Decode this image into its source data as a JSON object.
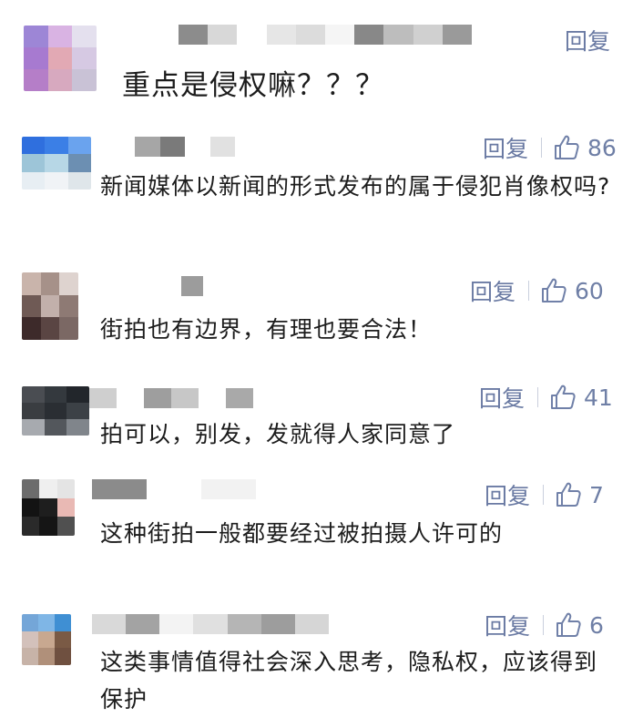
{
  "comments": [
    {
      "reply_label": "回复",
      "like_count": "",
      "text": "重点是侵权嘛？？？",
      "avatar_colors": [
        "#9d86d6",
        "#d9b3e3",
        "#e4e0ee",
        "#a77ad0",
        "#e2a9b4",
        "#d6c9e3",
        "#b57ec8",
        "#d7a9bf",
        "#c9c2d6"
      ],
      "username_colors": [
        "#8c8c8c",
        "#d8d8d8",
        "#ffffff",
        "#e6e6e6",
        "#dcdcdc",
        "#f5f5f5",
        "#888888",
        "#bdbdbd",
        "#d0d0d0",
        "#9a9a9a"
      ]
    },
    {
      "reply_label": "回复",
      "like_count": "86",
      "text": "新闻媒体以新闻的形式发布的属于侵犯肖像权吗?",
      "avatar_colors": [
        "#2f6fde",
        "#3b7fe6",
        "#6aa3ee",
        "#9dc5d8",
        "#b7d7e6",
        "#6c8fb2",
        "#e7eef3",
        "#f0f3f6",
        "#dfe6ea"
      ],
      "username_colors": [
        "#a6a6a6",
        "#7a7a7a",
        "#ffffff",
        "#e1e1e1"
      ]
    },
    {
      "reply_label": "回复",
      "like_count": "60",
      "text": "街拍也有边界，有理也要合法！",
      "avatar_colors": [
        "#c9b4ab",
        "#a69189",
        "#ded3cf",
        "#6f5a55",
        "#c2b0ab",
        "#8e7a74",
        "#3d2a2a",
        "#5a4543",
        "#7b6864"
      ],
      "username_colors": [
        "#9c9c9c"
      ]
    },
    {
      "reply_label": "回复",
      "like_count": "41",
      "text": "拍可以，别发，发就得人家同意了",
      "avatar_colors": [
        "#4a4d52",
        "#34393e",
        "#22262b",
        "#3a3d41",
        "#2a2e33",
        "#3c4146",
        "#a7aaaf",
        "#53575c",
        "#80858b"
      ],
      "username_colors": [
        "#cfcfcf",
        "#ffffff",
        "#9e9e9e",
        "#c7c7c7",
        "#ffffff",
        "#a9a9a9"
      ]
    },
    {
      "reply_label": "回复",
      "like_count": "7",
      "text": "这种街拍一般都要经过被拍摄人许可的",
      "avatar_colors": [
        "#6c6c6c",
        "#efefef",
        "#e4e4e4",
        "#131313",
        "#1e1e1e",
        "#e9b9b4",
        "#2a2a2a",
        "#151515",
        "#505050"
      ],
      "username_colors": [
        "#8b8b8b",
        "#ffffff",
        "#f2f2f2",
        "#ffffff"
      ]
    },
    {
      "reply_label": "回复",
      "like_count": "6",
      "text": "这类事情值得社会深入思考，隐私权，应该得到保护",
      "avatar_colors": [
        "#74a6d8",
        "#7fb6e6",
        "#3f8fd3",
        "#d3c1bb",
        "#c8a890",
        "#7a5a45",
        "#c7b3a8",
        "#b0907a",
        "#6f5040"
      ],
      "username_colors": [
        "#d9d9d9",
        "#a3a3a3",
        "#f3f3f3",
        "#e0e0e0",
        "#b5b5b5",
        "#9d9d9d",
        "#d6d6d6"
      ]
    }
  ]
}
